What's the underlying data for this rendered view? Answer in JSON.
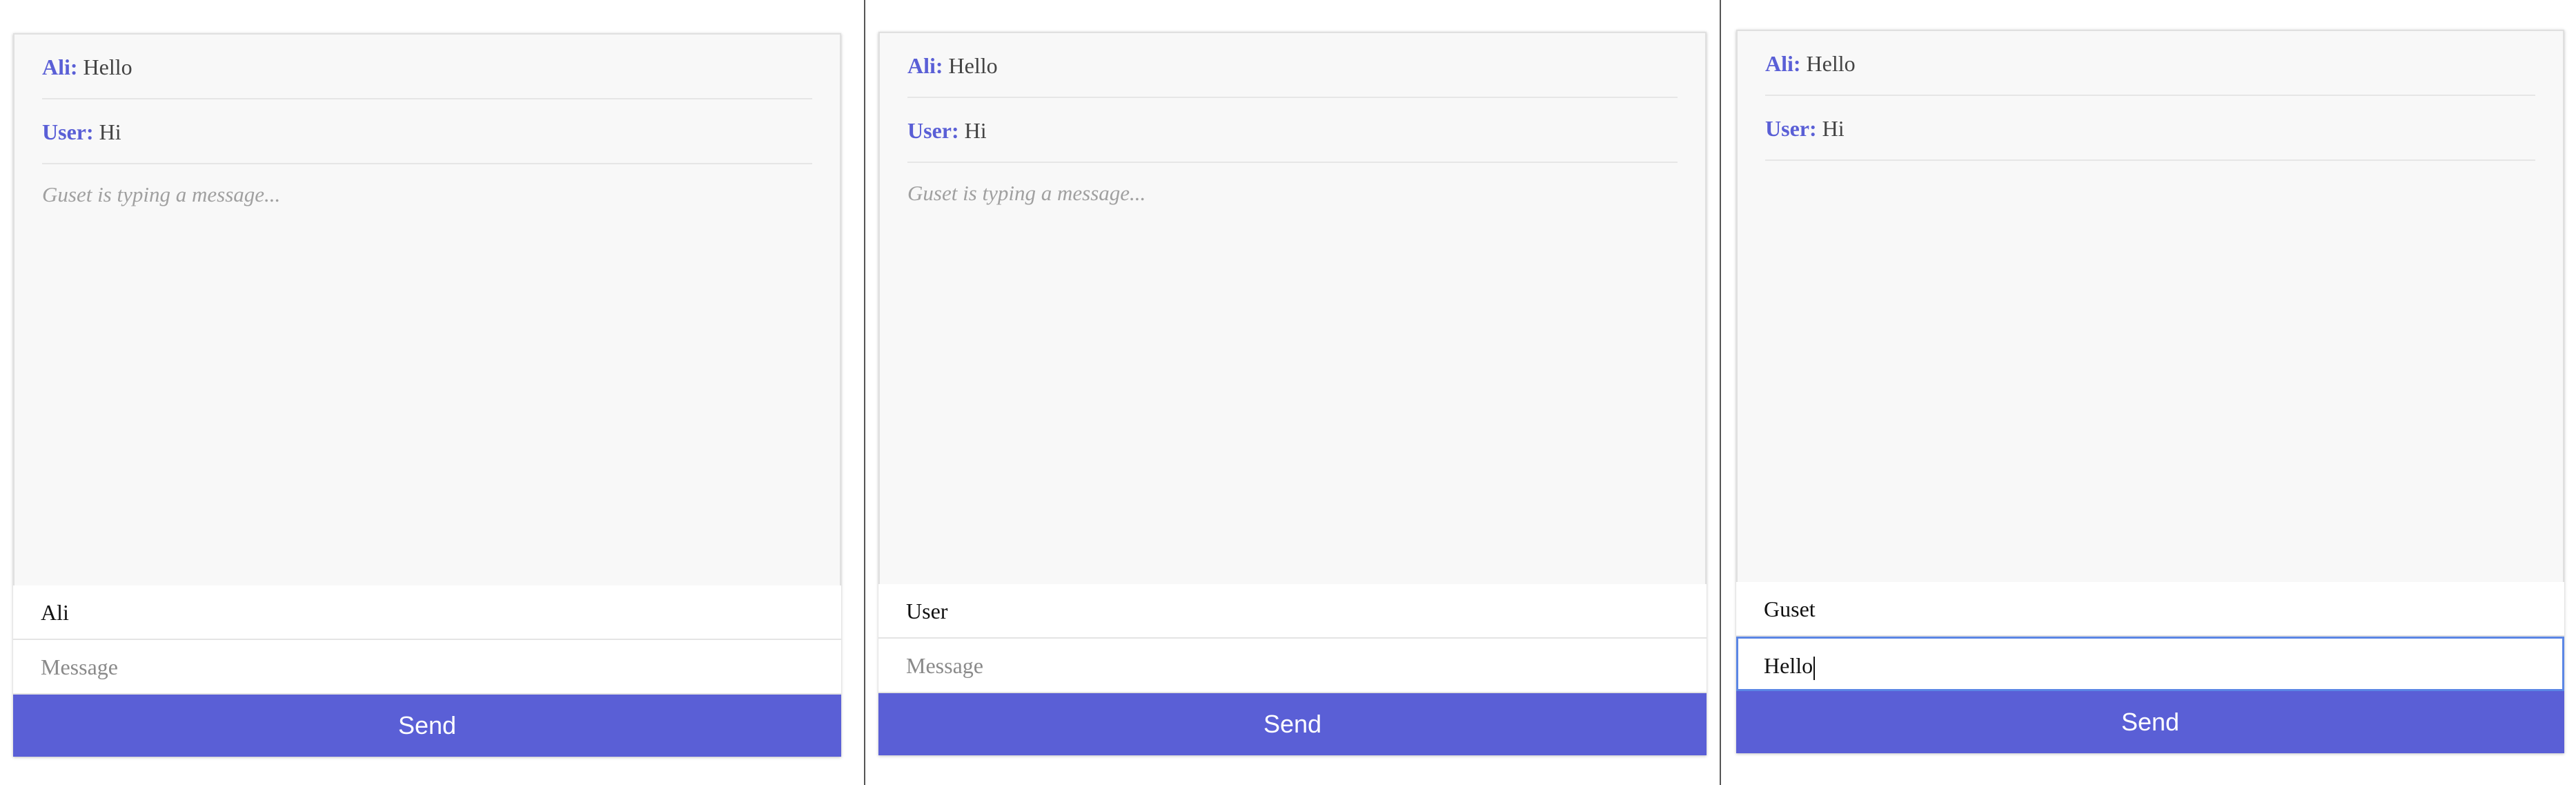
{
  "windows": [
    {
      "messages": [
        {
          "user": "Ali:",
          "text": "Hello"
        },
        {
          "user": "User:",
          "text": "Hi"
        }
      ],
      "typing_indicator": "Guset is typing a message...",
      "username_value": "Ali",
      "message_placeholder": "Message",
      "message_value": "",
      "send_label": "Send"
    },
    {
      "messages": [
        {
          "user": "Ali:",
          "text": "Hello"
        },
        {
          "user": "User:",
          "text": "Hi"
        }
      ],
      "typing_indicator": "Guset is typing a message...",
      "username_value": "User",
      "message_placeholder": "Message",
      "message_value": "",
      "send_label": "Send"
    },
    {
      "messages": [
        {
          "user": "Ali:",
          "text": "Hello"
        },
        {
          "user": "User:",
          "text": "Hi"
        }
      ],
      "typing_indicator": "",
      "username_value": "Guset",
      "message_placeholder": "Message",
      "message_value": "Hello",
      "send_label": "Send"
    }
  ],
  "colors": {
    "accent": "#5a5fd6",
    "message_area_bg": "#f8f8f8",
    "focus_border": "#5b86e5"
  }
}
